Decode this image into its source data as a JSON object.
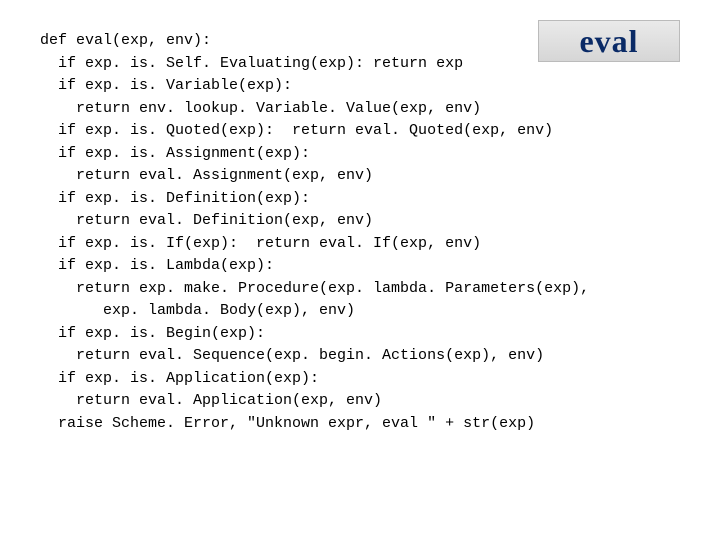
{
  "badge": {
    "label": "eval"
  },
  "code": {
    "lines": [
      "def eval(exp, env):",
      "  if exp. is. Self. Evaluating(exp): return exp",
      "  if exp. is. Variable(exp):",
      "    return env. lookup. Variable. Value(exp, env)",
      "  if exp. is. Quoted(exp):  return eval. Quoted(exp, env)",
      "  if exp. is. Assignment(exp):",
      "    return eval. Assignment(exp, env)",
      "  if exp. is. Definition(exp):",
      "    return eval. Definition(exp, env)",
      "  if exp. is. If(exp):  return eval. If(exp, env)",
      "  if exp. is. Lambda(exp):",
      "    return exp. make. Procedure(exp. lambda. Parameters(exp),",
      "       exp. lambda. Body(exp), env)",
      "  if exp. is. Begin(exp):",
      "    return eval. Sequence(exp. begin. Actions(exp), env)",
      "  if exp. is. Application(exp):",
      "    return eval. Application(exp, env)",
      "  raise Scheme. Error, \"Unknown expr, eval \" + str(exp)"
    ]
  }
}
